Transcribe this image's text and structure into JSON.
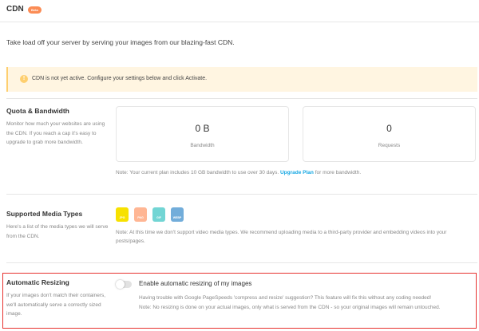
{
  "header": {
    "title": "CDN",
    "badge": "Beta"
  },
  "intro": "Take load off your server by serving your images from our blazing-fast CDN.",
  "notice": {
    "icon": "warning-icon",
    "icon_glyph": "!",
    "text": "CDN is not yet active. Configure your settings below and click Activate."
  },
  "quota": {
    "title": "Quota & Bandwidth",
    "description": "Monitor how much your websites are using the CDN. If you reach a cap it's easy to upgrade to grab more bandwidth.",
    "stats": [
      {
        "value": "0 B",
        "label": "Bandwidth"
      },
      {
        "value": "0",
        "label": "Requests"
      }
    ],
    "note_prefix": "Note: Your current plan includes 10 GB bandwidth to use over 30 days.",
    "upgrade_link": "Upgrade Plan",
    "note_suffix": "for more bandwidth."
  },
  "media": {
    "title": "Supported Media Types",
    "description": "Here's a list of the media types we will serve from the CDN.",
    "types": [
      {
        "label": "JPG",
        "color": "#f7e100"
      },
      {
        "label": "PNG",
        "color": "#ffb694"
      },
      {
        "label": "GIF",
        "color": "#72d5d4"
      },
      {
        "label": "WEBP",
        "color": "#72adda"
      }
    ],
    "note": "Note: At this time we don't support video media types. We recommend uploading media to a third-party provider and embedding videos into your posts/pages."
  },
  "resizing": {
    "title": "Automatic Resizing",
    "description": "If your images don't match their containers, we'll automatically serve a correctly sized image.",
    "toggle_label": "Enable automatic resizing of my images",
    "toggle_on": false,
    "note_1": "Having trouble with Google PageSpeeds 'compress and resize' suggestion? This feature will fix this without any coding needed!",
    "note_2": "Note: No resizing is done on your actual images, only what is served from the CDN - so your original images will remain untouched."
  },
  "colors": {
    "accent": "#17a8e3",
    "badge": "#fb8c55",
    "highlight": "#e8322f",
    "notice_bg": "#fff5e1",
    "notice_border": "#fecf6f"
  }
}
